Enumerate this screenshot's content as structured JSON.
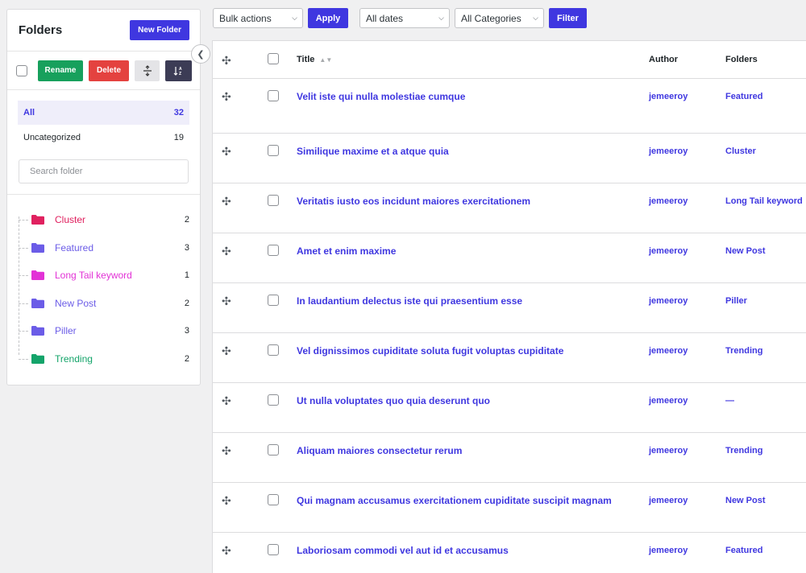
{
  "sidebar": {
    "title": "Folders",
    "new_folder_label": "New Folder",
    "rename_label": "Rename",
    "delete_label": "Delete",
    "all": {
      "label": "All",
      "count": "32"
    },
    "uncategorized": {
      "label": "Uncategorized",
      "count": "19"
    },
    "search_placeholder": "Search folder",
    "folders": [
      {
        "name": "Cluster",
        "count": "2",
        "color": "#e0215f"
      },
      {
        "name": "Featured",
        "count": "3",
        "color": "#6b5ce7"
      },
      {
        "name": "Long Tail keyword",
        "count": "1",
        "color": "#e232d6"
      },
      {
        "name": "New Post",
        "count": "2",
        "color": "#6b5ce7"
      },
      {
        "name": "Piller",
        "count": "3",
        "color": "#6b5ce7"
      },
      {
        "name": "Trending",
        "count": "2",
        "color": "#14a46a"
      }
    ]
  },
  "filters": {
    "bulk_actions": "Bulk actions",
    "apply_label": "Apply",
    "dates": "All dates",
    "categories": "All Categories",
    "filter_label": "Filter"
  },
  "table": {
    "columns": {
      "title": "Title",
      "author": "Author",
      "folders": "Folders"
    },
    "rows": [
      {
        "title": "Velit iste qui nulla molestiae cumque",
        "author": "jemeeroy",
        "folder": "Featured"
      },
      {
        "title": "Similique maxime et a atque quia",
        "author": "jemeeroy",
        "folder": "Cluster"
      },
      {
        "title": "Veritatis iusto eos incidunt maiores exercitationem",
        "author": "jemeeroy",
        "folder": "Long Tail keyword"
      },
      {
        "title": "Amet et enim maxime",
        "author": "jemeeroy",
        "folder": "New Post"
      },
      {
        "title": "In laudantium delectus iste qui praesentium esse",
        "author": "jemeeroy",
        "folder": "Piller"
      },
      {
        "title": "Vel dignissimos cupiditate soluta fugit voluptas cupiditate",
        "author": "jemeeroy",
        "folder": "Trending"
      },
      {
        "title": "Ut nulla voluptates quo quia deserunt quo",
        "author": "jemeeroy",
        "folder": "—"
      },
      {
        "title": "Aliquam maiores consectetur rerum",
        "author": "jemeeroy",
        "folder": "Trending"
      },
      {
        "title": "Qui magnam accusamus exercitationem cupiditate suscipit magnam",
        "author": "jemeeroy",
        "folder": "New Post"
      },
      {
        "title": "Laboriosam commodi vel aut id et accusamus",
        "author": "jemeeroy",
        "folder": "Featured"
      }
    ]
  }
}
